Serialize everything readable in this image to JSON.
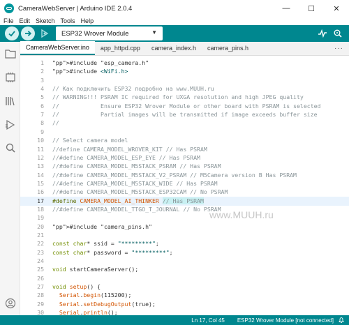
{
  "window": {
    "title": "CameraWebServer | Arduino IDE 2.0.4",
    "minimize": "—",
    "maximize": "☐",
    "close": "✕"
  },
  "menu": [
    "File",
    "Edit",
    "Sketch",
    "Tools",
    "Help"
  ],
  "toolbar": {
    "board": "ESP32 Wrover Module",
    "accent": "#00878f"
  },
  "tabs": [
    "CameraWebServer.ino",
    "app_httpd.cpp",
    "camera_index.h",
    "camera_pins.h"
  ],
  "tabs_more": "···",
  "editor": {
    "lines": [
      {
        "n": "1",
        "code": "#include \"esp_camera.h\""
      },
      {
        "n": "2",
        "code": "#include <WiFi.h>"
      },
      {
        "n": "3",
        "code": ""
      },
      {
        "n": "4",
        "code": "// Как подключить ESP32 подробно на www.MUUH.ru"
      },
      {
        "n": "5",
        "code": "// WARNING!!! PSRAM IC required for UXGA resolution and high JPEG quality"
      },
      {
        "n": "6",
        "code": "//            Ensure ESP32 Wrover Module or other board with PSRAM is selected"
      },
      {
        "n": "7",
        "code": "//            Partial images will be transmitted if image exceeds buffer size"
      },
      {
        "n": "8",
        "code": "//"
      },
      {
        "n": "9",
        "code": ""
      },
      {
        "n": "10",
        "code": "// Select camera model"
      },
      {
        "n": "11",
        "code": "//define CAMERA_MODEL_WROVER_KIT // Has PSRAM"
      },
      {
        "n": "12",
        "code": "//#define CAMERA_MODEL_ESP_EYE // Has PSRAM"
      },
      {
        "n": "13",
        "code": "//#define CAMERA_MODEL_M5STACK_PSRAM // Has PSRAM"
      },
      {
        "n": "14",
        "code": "//#define CAMERA_MODEL_M5STACK_V2_PSRAM // M5Camera version B Has PSRAM"
      },
      {
        "n": "15",
        "code": "//#define CAMERA_MODEL_M5STACK_WIDE // Has PSRAM"
      },
      {
        "n": "16",
        "code": "//#define CAMERA_MODEL_M5STACK_ESP32CAM // No PSRAM"
      },
      {
        "n": "17",
        "code": "#define CAMERA_MODEL_AI_THINKER // Has PSRAM"
      },
      {
        "n": "18",
        "code": "//#define CAMERA_MODEL_TTGO_T_JOURNAL // No PSRAM"
      },
      {
        "n": "19",
        "code": ""
      },
      {
        "n": "20",
        "code": "#include \"camera_pins.h\""
      },
      {
        "n": "21",
        "code": ""
      },
      {
        "n": "22",
        "code": "const char* ssid = \"*********\";"
      },
      {
        "n": "23",
        "code": "const char* password = \"*********\";"
      },
      {
        "n": "24",
        "code": ""
      },
      {
        "n": "25",
        "code": "void startCameraServer();"
      },
      {
        "n": "26",
        "code": ""
      },
      {
        "n": "27",
        "code": "void setup() {"
      },
      {
        "n": "28",
        "code": "  Serial.begin(115200);"
      },
      {
        "n": "29",
        "code": "  Serial.setDebugOutput(true);"
      },
      {
        "n": "30",
        "code": "  Serial.println();"
      }
    ],
    "watermark": "www.MUUH.ru"
  },
  "status": {
    "position": "Ln 17, Col 45",
    "board": "ESP32 Wrover Module [not connected]",
    "bell_icon": "bell-icon"
  }
}
